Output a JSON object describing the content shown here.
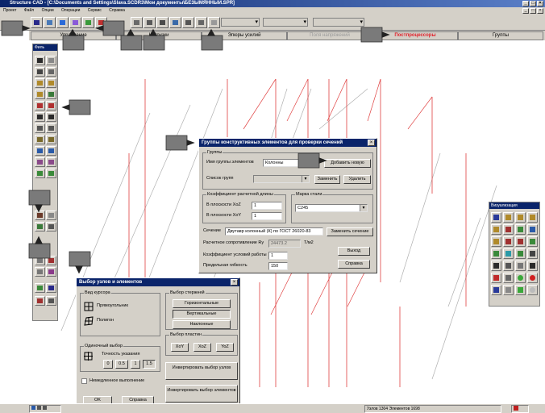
{
  "app": {
    "title": "Structure CAD - [C:\\Documents and Settings\\Slava.SCDR3\\Мои документы\\БЕЗЫМЯННЫЙ.SPR]",
    "window_controls": [
      "_",
      "□",
      "×"
    ]
  },
  "menu": {
    "items": [
      "Проект",
      "Файл",
      "Опции",
      "Операции",
      "Сервис",
      "Справка"
    ],
    "mdi_controls": [
      "_",
      "□",
      "×"
    ]
  },
  "tabs": [
    {
      "label": "Управление"
    },
    {
      "label": "Нагрузки"
    },
    {
      "label": "Эпюры усилий"
    },
    {
      "label": "Поля напряжений"
    },
    {
      "label": "Постпроцессоры"
    },
    {
      "label": "Группы"
    }
  ],
  "palette_left": {
    "title": "Филь"
  },
  "palette_right": {
    "title": "Визуализация"
  },
  "colors": {
    "title_bg": "#0a246a",
    "chrome": "#d4d0c8",
    "accent_red": "#e0202a",
    "structure_red": "#e04040",
    "structure_gray": "#b0b0b0"
  },
  "groups_dialog": {
    "title": "Группы конструктивных элементов для проверки сечений",
    "close": "×",
    "group_box": "Группы",
    "name_label": "Имя группы элементов",
    "name_value": "Колонны",
    "add_button": "Добавить новую",
    "list_label": "Список групп",
    "replace_button": "Заменить",
    "delete_button": "Удалить",
    "length_box": "Коэффициент расчетной длины",
    "plane_xoz_label": "В плоскости XoZ",
    "plane_xoz_value": "1",
    "plane_xoy_label": "В плоскости XoY",
    "plane_xoy_value": "1",
    "steel_box": "Марка стали",
    "steel_value": "C245",
    "section_label": "Сечение",
    "section_value": "Двутавр колонный (К) по ГОСТ 26020-83",
    "change_section_button": "Заменить сечение",
    "resistance_label": "Расчетное сопротивление Ry",
    "resistance_value": "24473.2",
    "resistance_unit": "T/м2",
    "work_coef_label": "Коэффициент условий работы",
    "work_coef_value": "1",
    "flexibility_label": "Предельная гибкость",
    "flexibility_value": "150",
    "exit_button": "Выход",
    "help_button": "Справка"
  },
  "selection_dialog": {
    "title": "Выбор узлов и элементов",
    "close": "×",
    "cursor_box": "Вид курсора",
    "rect_label": "Прямоугольник",
    "polygon_label": "Полигон",
    "single_box": "Одиночный выбор",
    "precision_label": "Точность указания",
    "precision_options": [
      "0",
      "0.5",
      "1",
      "1.5"
    ],
    "immediate_label": "Немедленное выполнение",
    "ok_button": "OK",
    "help_button": "Справка",
    "rods_box": "Выбор стержней",
    "horizontal_button": "Горизонтальные",
    "vertical_button": "Вертикальные",
    "inclined_button": "Наклонные",
    "plates_box": "Выбор пластин",
    "xoy_button": "XoY",
    "xoz_button": "XoZ",
    "yoz_button": "YoZ",
    "invert_nodes_button": "Инвертировать выбор узлов",
    "invert_elements_button": "Инвертировать выбор элементов"
  },
  "status": {
    "nodes_elements": "Узлов 1304 Элементов 1698"
  }
}
